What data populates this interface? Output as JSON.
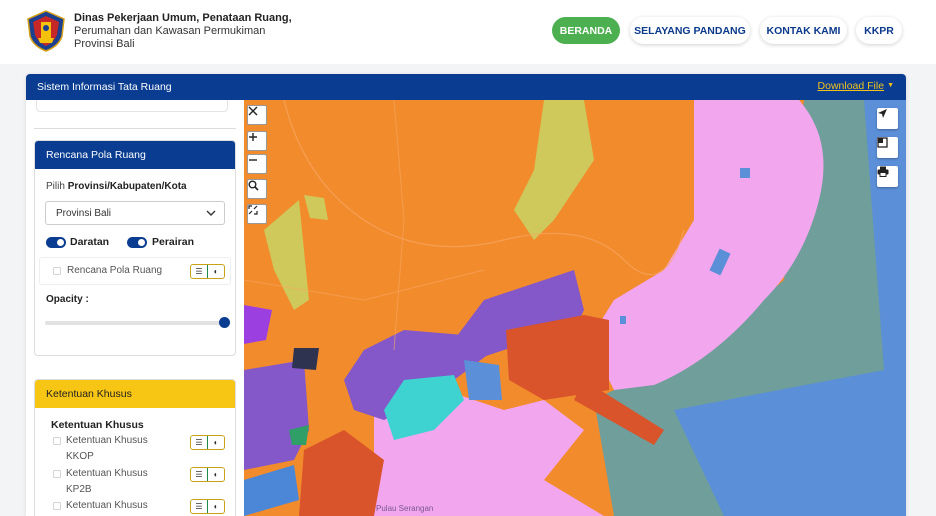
{
  "header": {
    "agency_line1": "Dinas Pekerjaan Umum, Penataan Ruang,",
    "agency_line2": "Perumahan dan Kawasan Permukiman",
    "agency_line3": "Provinsi Bali",
    "logo_icon": "bali-province-emblem-icon",
    "nav": [
      {
        "label": "BERANDA",
        "active": true
      },
      {
        "label": "SELAYANG PANDANG",
        "active": false
      },
      {
        "label": "KONTAK KAMI",
        "active": false
      },
      {
        "label": "KKPR",
        "active": false
      }
    ]
  },
  "panel": {
    "title": "Sistem Informasi Tata Ruang",
    "download_label": "Download File"
  },
  "pola_ruang": {
    "title": "Rencana Pola Ruang",
    "select_prefix": "Pilih ",
    "select_label_bold": "Provinsi/Kabupaten/Kota",
    "select_value": "Provinsi Bali",
    "toggle_darat": "Daratan",
    "toggle_perairan": "Perairan",
    "layer_name": "Rencana Pola Ruang",
    "opacity_label": "Opacity :",
    "opacity_value": 1.0
  },
  "ketentuan": {
    "title": "Ketentuan Khusus",
    "subtitle": "Ketentuan Khusus",
    "items": [
      {
        "line1": "Ketentuan Khusus",
        "line2": "KKOP"
      },
      {
        "line1": "Ketentuan Khusus",
        "line2": "KP2B"
      },
      {
        "line1": "Ketentuan Khusus",
        "line2": ""
      }
    ]
  },
  "map": {
    "place_label": "Pulau Serangan",
    "controls_left": [
      "close-icon",
      "zoom-in-icon",
      "zoom-out-icon",
      "search-icon",
      "fullscreen-icon"
    ],
    "controls_right": [
      "locate-arrow-icon",
      "basemap-layers-icon",
      "print-icon"
    ]
  },
  "colors": {
    "brand_blue": "#0a3d91",
    "accent_green": "#4caf50",
    "accent_yellow": "#f7c514",
    "zone_orange": "#f28b2c",
    "zone_pink": "#f2a6ee",
    "zone_purple": "#8458c9",
    "zone_olive": "#cfc85a",
    "zone_sea": "#5b8fd8"
  }
}
